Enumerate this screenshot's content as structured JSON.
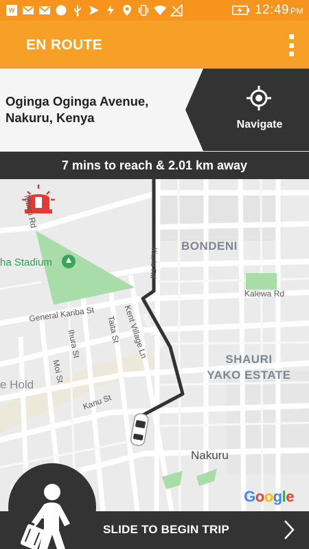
{
  "status_bar": {
    "time": "12:49",
    "ampm": "PM",
    "icons": [
      "wasili-icon",
      "gmail-icon",
      "gmail-icon",
      "circle-icon",
      "usb-icon",
      "navigation-icon",
      "flash-icon",
      "location-icon",
      "vibrate-icon",
      "wifi-icon",
      "no-signal-icon",
      "battery-charging-icon"
    ]
  },
  "app_bar": {
    "title": "EN ROUTE",
    "menu_icon": "more-vert-icon"
  },
  "destination": {
    "address_line1": "Oginga Oginga Avenue,",
    "address_line2": "Nakuru, Kenya"
  },
  "navigate": {
    "label": "Navigate",
    "icon": "gps-target-icon"
  },
  "eta": {
    "text": "7 mins to reach & 2.01 km away"
  },
  "map": {
    "areas": {
      "bondeni": "BONDENI",
      "shauri_line1": "SHAURI",
      "shauri_line2": "YAKO ESTATE",
      "nakuru": "Nakuru"
    },
    "park": "ha Stadium",
    "poi": "e Hold",
    "streets": {
      "general_kariba": "General Kariba St",
      "ihura": "Ihura St",
      "taita": "Taita St",
      "kent_village": "Kent Village Ln",
      "moi": "Moi St",
      "kanu": "Kanu St",
      "kalewa": "Kalewa Rd",
      "kiarie": "Kiarie Rd",
      "ndeng": "Ndeng'a St",
      "mbiru": "Mbiru Rd"
    },
    "attribution": "Google",
    "colors": {
      "route": "#333333",
      "park": "#a8dca8",
      "alert": "#e53935"
    }
  },
  "slide": {
    "label": "SLIDE TO BEGIN TRIP",
    "knob_icon": "traveler-luggage-icon",
    "chevron_icon": "chevron-right-icon"
  },
  "colors": {
    "accent": "#f7a028",
    "dark": "#333333"
  }
}
